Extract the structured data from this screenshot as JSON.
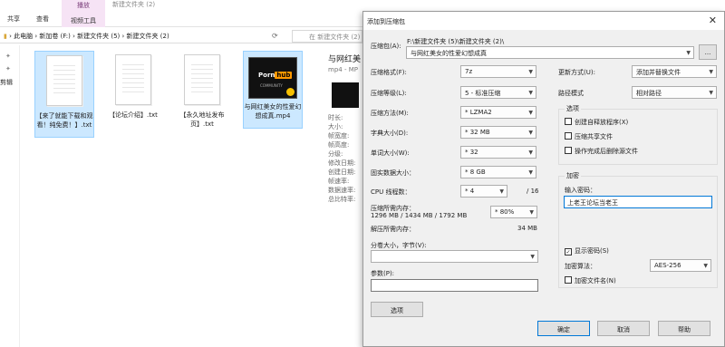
{
  "ribbon": {
    "tabs": [
      "共享",
      "查看"
    ],
    "context_group": "播放",
    "context_tab": "视频工具",
    "window_title": "新建文件夹 (2)"
  },
  "address": {
    "crumbs": [
      "此电脑",
      "新加卷 (F:)",
      "新建文件夹 (5)",
      "新建文件夹 (2)"
    ],
    "search_placeholder": "在 新建文件夹 (2) 中搜索"
  },
  "nav": {
    "item": "剪辑"
  },
  "files": [
    {
      "name": "【来了就能下载和观看！纯免费！】.txt",
      "type": "text"
    },
    {
      "name": "【论坛介绍】.txt",
      "type": "text"
    },
    {
      "name": "【永久地址发布页】.txt",
      "type": "text"
    },
    {
      "name": "与网红美女的性爱幻想成真.mp4",
      "type": "video"
    }
  ],
  "thumb": {
    "logo_a": "Porn",
    "logo_b": "hub",
    "sub": "COMMUNITY"
  },
  "preview": {
    "title": "与网红美",
    "subtitle": "mp4 - MP",
    "props": [
      "时长:",
      "大小:",
      "帧宽度:",
      "帧高度:",
      "分级:",
      "修改日期:",
      "创建日期:",
      "帧速率:",
      "数据速率:",
      "总比特率:"
    ]
  },
  "dialog": {
    "title": "添加到压缩包",
    "archive_label": "压缩包(A):",
    "archive_path": "F:\\新建文件夹 (5)\\新建文件夹 (2)\\",
    "archive_name": "与网红美女的性爱幻想成真",
    "browse_label": "...",
    "format_label": "压缩格式(F):",
    "format_value": "7z",
    "level_label": "压缩等级(L):",
    "level_value": "5 - 标准压缩",
    "method_label": "压缩方法(M):",
    "method_value": "* LZMA2",
    "dict_label": "字典大小(D):",
    "dict_value": "* 32 MB",
    "word_label": "单词大小(W):",
    "word_value": "* 32",
    "solid_label": "固实数据大小：",
    "solid_value": "* 8 GB",
    "cpu_label": "CPU 线程数：",
    "cpu_value": "* 4",
    "cpu_max": "/ 16",
    "mem_label": "压缩所需内存：",
    "mem_detail": "1296 MB / 1434 MB / 1792 MB",
    "mem_percent": "* 80%",
    "demem_label": "解压所需内存：",
    "demem_value": "34 MB",
    "split_label": "分卷大小，字节(V):",
    "params_label": "参数(P):",
    "options_btn": "选项",
    "update_label": "更新方式(U):",
    "update_value": "添加并替换文件",
    "path_label": "路径模式",
    "path_value": "相对路径",
    "options_group": "选项",
    "opt_sfx": "创建自释放程序(X)",
    "opt_shared": "压缩共享文件",
    "opt_delete": "操作完成后删除源文件",
    "enc_group": "加密",
    "pwd_label": "输入密码：",
    "pwd_value": "上老王论坛当老王",
    "show_pwd": "显示密码(S)",
    "enc_method_label": "加密算法：",
    "enc_method_value": "AES-256",
    "enc_names": "加密文件名(N)",
    "ok": "确定",
    "cancel": "取消",
    "help": "帮助"
  }
}
